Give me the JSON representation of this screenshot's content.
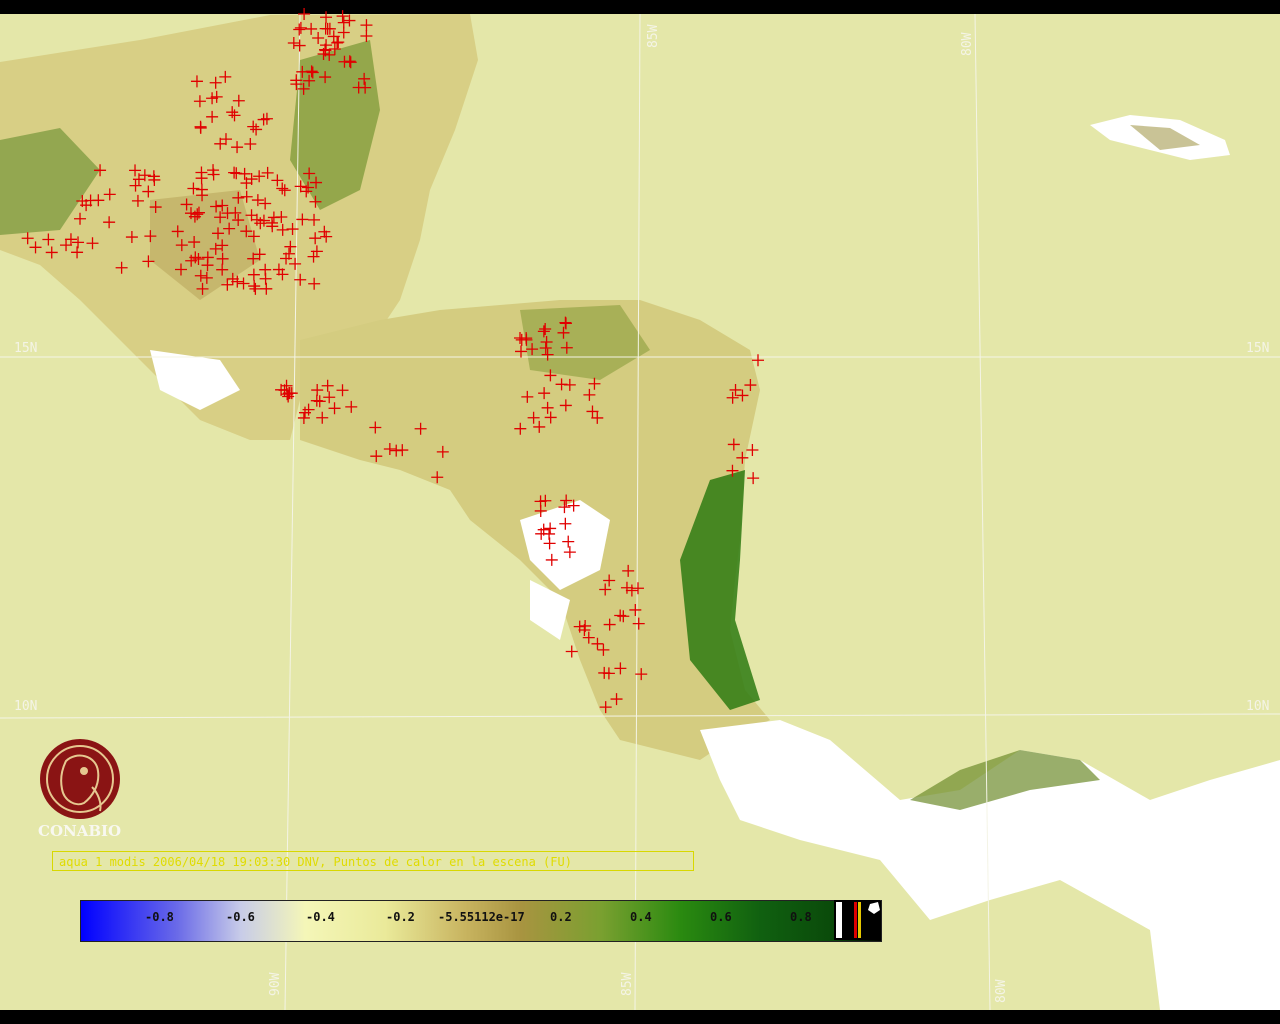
{
  "map": {
    "latitude_labels": [
      "15N",
      "10N"
    ],
    "longitude_labels": [
      "85W",
      "80W",
      "90W"
    ],
    "colors": {
      "sea": "#e4e7a9",
      "land_dry": "#c8b460",
      "land_green": "#2a8a10",
      "cloud": "#ffffff",
      "fire_marker": "#e00000",
      "grid": "#f4f4e6"
    }
  },
  "logo": {
    "text": "CONABIO",
    "icon": "conabio-logo-icon"
  },
  "caption": {
    "text": "aqua 1 modis 2006/04/18 19:03:30 DNV, Puntos de calor en la escena (FU)"
  },
  "colorbar": {
    "ticks": [
      "-0.8",
      "-0.6",
      "-0.4",
      "-0.2",
      "-5.55112e-17",
      "0.2",
      "0.4",
      "0.6",
      "0.8"
    ],
    "range": [
      -1,
      1
    ]
  }
}
